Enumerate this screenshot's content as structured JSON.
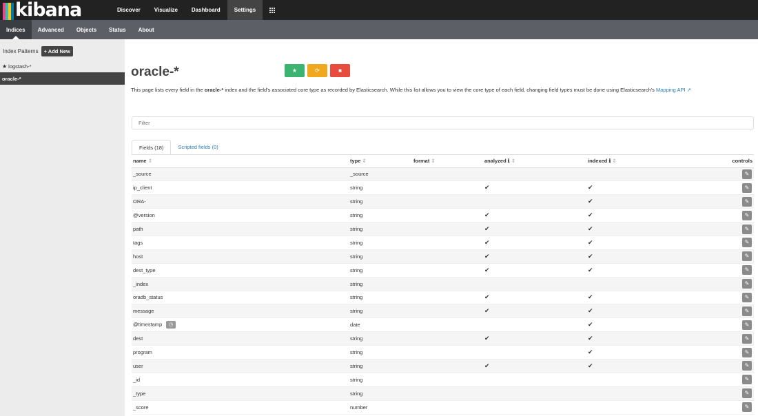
{
  "logo": {
    "text": "kibana",
    "bar_colors": [
      "#e8478b",
      "#3ebeb0",
      "#fec514",
      "#0079a5"
    ]
  },
  "topnav": [
    "Discover",
    "Visualize",
    "Dashboard",
    "Settings"
  ],
  "topnav_active": "Settings",
  "subnav": [
    "Indices",
    "Advanced",
    "Objects",
    "Status",
    "About"
  ],
  "subnav_active": "Indices",
  "sidebar": {
    "heading": "Index Patterns",
    "add_button": "+ Add New",
    "items": [
      {
        "label": "logstash-*",
        "default": true
      },
      {
        "label": "oracle-*",
        "active": true
      }
    ]
  },
  "page": {
    "title": "oracle-*",
    "desc_prefix": "This page lists every field in the ",
    "desc_index": "oracle-*",
    "desc_mid": " index and the field's associated core type as recorded by Elasticsearch. While this list allows you to view the core type of each field, changing field types must be done using Elasticsearch's ",
    "desc_link": "Mapping API"
  },
  "filter": {
    "placeholder": "Filter"
  },
  "tabs": [
    "Fields (18)",
    "Scripted fields (0)"
  ],
  "table": {
    "headers": {
      "name": "name",
      "type": "type",
      "format": "format",
      "analyzed": "analyzed",
      "indexed": "indexed",
      "controls": "controls"
    },
    "rows": [
      {
        "name": "_source",
        "type": "_source",
        "analyzed": false,
        "indexed": false
      },
      {
        "name": "ip_client",
        "type": "string",
        "analyzed": true,
        "indexed": true
      },
      {
        "name": "ORA-",
        "type": "string",
        "analyzed": false,
        "indexed": true
      },
      {
        "name": "@version",
        "type": "string",
        "analyzed": true,
        "indexed": true
      },
      {
        "name": "path",
        "type": "string",
        "analyzed": true,
        "indexed": true
      },
      {
        "name": "tags",
        "type": "string",
        "analyzed": true,
        "indexed": true
      },
      {
        "name": "host",
        "type": "string",
        "analyzed": true,
        "indexed": true
      },
      {
        "name": "dest_type",
        "type": "string",
        "analyzed": true,
        "indexed": true
      },
      {
        "name": "_index",
        "type": "string",
        "analyzed": false,
        "indexed": false
      },
      {
        "name": "oradb_status",
        "type": "string",
        "analyzed": true,
        "indexed": true
      },
      {
        "name": "message",
        "type": "string",
        "analyzed": true,
        "indexed": true
      },
      {
        "name": "@timestamp",
        "type": "date",
        "analyzed": false,
        "indexed": true,
        "time_field": true
      },
      {
        "name": "dest",
        "type": "string",
        "analyzed": true,
        "indexed": true
      },
      {
        "name": "program",
        "type": "string",
        "analyzed": false,
        "indexed": true
      },
      {
        "name": "user",
        "type": "string",
        "analyzed": true,
        "indexed": true
      },
      {
        "name": "_id",
        "type": "string",
        "analyzed": false,
        "indexed": false
      },
      {
        "name": "_type",
        "type": "string",
        "analyzed": false,
        "indexed": false
      },
      {
        "name": "_score",
        "type": "number",
        "analyzed": false,
        "indexed": false
      }
    ]
  }
}
